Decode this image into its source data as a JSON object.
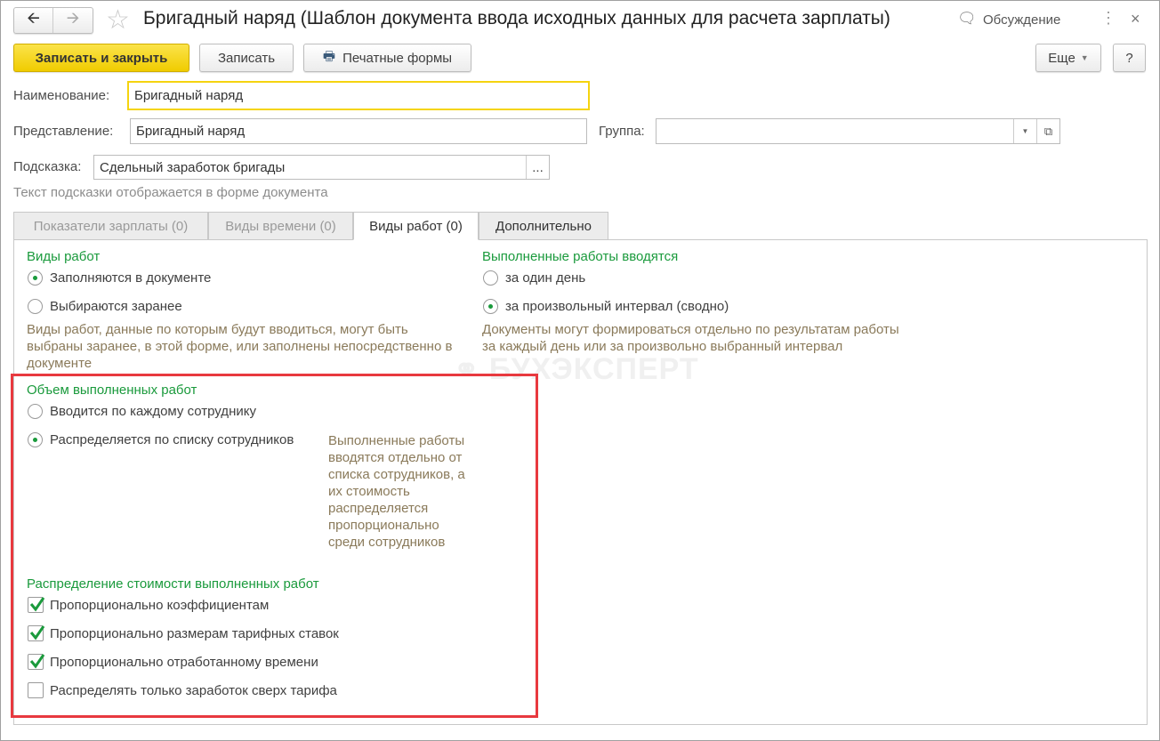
{
  "window": {
    "title": "Бригадный наряд (Шаблон документа ввода исходных данных для расчета зарплаты)",
    "discussion": "Обсуждение"
  },
  "toolbar": {
    "save_close": "Записать и закрыть",
    "save": "Записать",
    "print": "Печатные формы",
    "more": "Еще",
    "help": "?"
  },
  "form": {
    "name_label": "Наименование:",
    "name_value": "Бригадный наряд",
    "repr_label": "Представление:",
    "repr_value": "Бригадный наряд",
    "group_label": "Группа:",
    "group_value": "",
    "hint_label": "Подсказка:",
    "hint_value": "Сдельный заработок бригады",
    "hint_button": "...",
    "hint_note": "Текст подсказки отображается в форме документа"
  },
  "tabs": [
    {
      "label": "Показатели зарплаты (0)"
    },
    {
      "label": "Виды времени (0)"
    },
    {
      "label": "Виды работ (0)"
    },
    {
      "label": "Дополнительно"
    }
  ],
  "work_types": {
    "title": "Виды работ",
    "options": [
      "Заполняются в документе",
      "Выбираются заранее"
    ],
    "selected": 0,
    "note": "Виды работ, данные по которым будут вводиться, могут быть выбраны заранее, в этой форме, или заполнены непосредственно в документе"
  },
  "entered": {
    "title": "Выполненные работы вводятся",
    "options": [
      "за один день",
      "за произвольный интервал (сводно)"
    ],
    "selected": 1,
    "note": "Документы могут формироваться отдельно по результатам работы за каждый день или за произвольно выбранный интервал"
  },
  "volume": {
    "title": "Объем выполненных работ",
    "options": [
      "Вводится по каждому сотруднику",
      "Распределяется по списку сотрудников"
    ],
    "selected": 1,
    "note": "Выполненные работы вводятся отдельно от списка сотрудников, а их стоимость распределяется пропорционально среди сотрудников"
  },
  "distribution": {
    "title": "Распределение стоимости выполненных работ",
    "items": [
      {
        "label": "Пропорционально коэффициентам",
        "checked": true
      },
      {
        "label": "Пропорционально размерам тарифных ставок",
        "checked": true
      },
      {
        "label": "Пропорционально отработанному времени",
        "checked": true
      },
      {
        "label": "Распределять только заработок сверх тарифа",
        "checked": false
      }
    ]
  },
  "watermark": "БУХЭКСПЕРТ",
  "colors": {
    "accent_green": "#1a9a3c",
    "primary_yellow": "#f5d40f",
    "highlight_red": "#e8393f"
  }
}
